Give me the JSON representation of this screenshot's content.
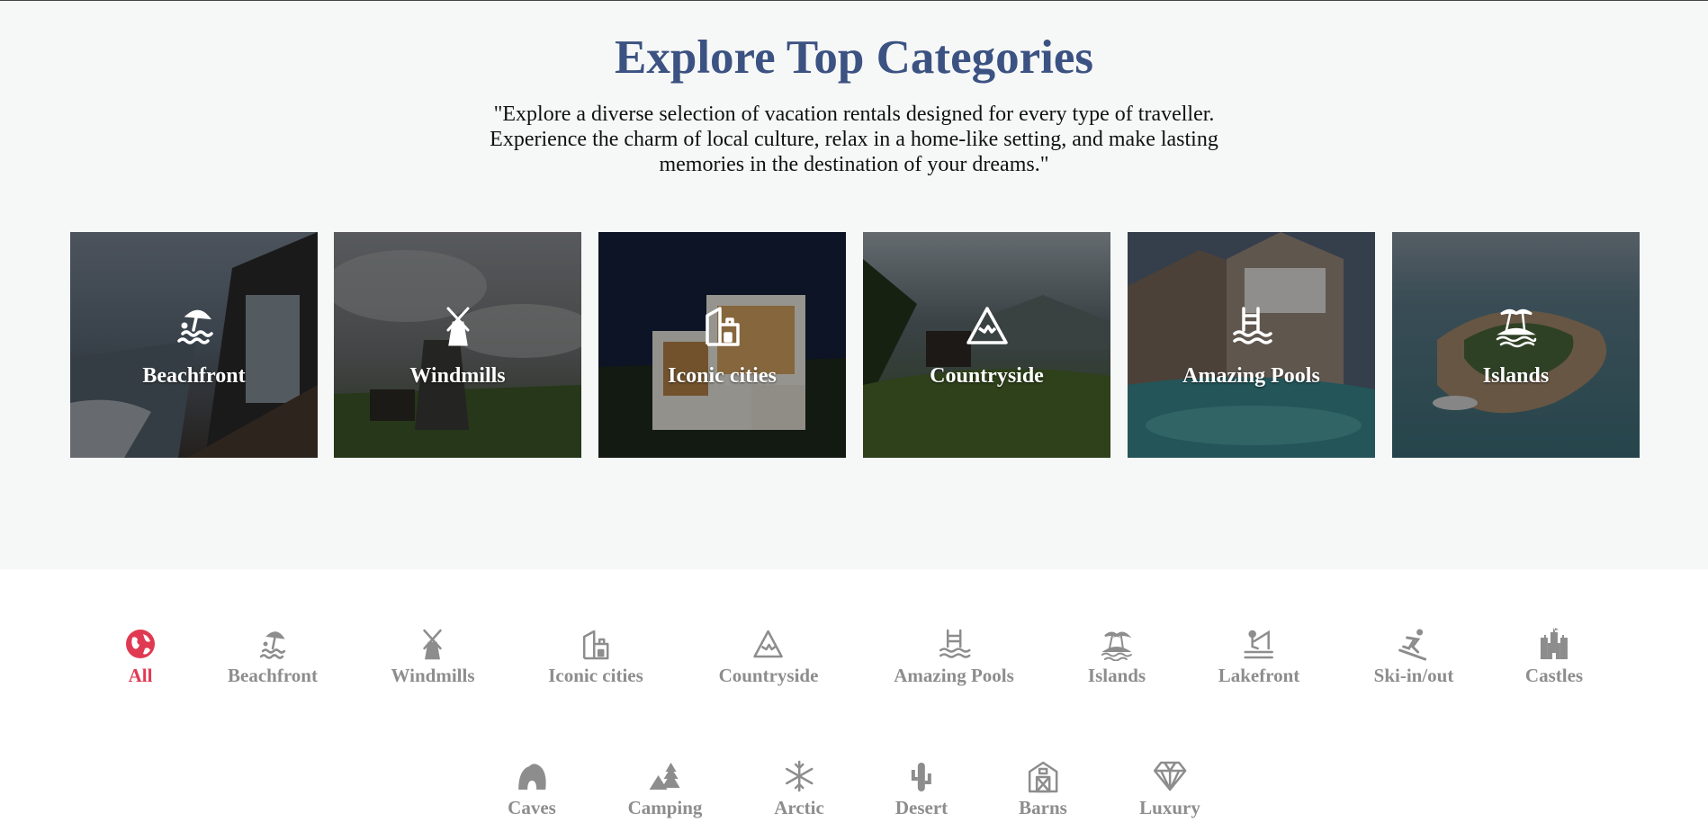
{
  "hero": {
    "title": "Explore Top Categories",
    "description": "\"Explore a diverse selection of vacation rentals designed for every type of traveller. Experience the charm of local culture, relax in a home-like setting, and make lasting memories in the destination of your dreams.\""
  },
  "cards": [
    {
      "label": "Beachfront",
      "icon": "beach-umbrella-icon"
    },
    {
      "label": "Windmills",
      "icon": "windmill-icon"
    },
    {
      "label": "Iconic cities",
      "icon": "city-building-icon"
    },
    {
      "label": "Countryside",
      "icon": "mountain-icon"
    },
    {
      "label": "Amazing Pools",
      "icon": "pool-icon"
    },
    {
      "label": "Islands",
      "icon": "island-icon"
    }
  ],
  "filters": {
    "active_color": "#e03a52",
    "inactive_color": "#8d8d8d",
    "row1": [
      {
        "label": "All",
        "icon": "globe-icon"
      },
      {
        "label": "Beachfront",
        "icon": "beach-umbrella-icon"
      },
      {
        "label": "Windmills",
        "icon": "windmill-icon"
      },
      {
        "label": "Iconic cities",
        "icon": "city-building-icon"
      },
      {
        "label": "Countryside",
        "icon": "mountain-icon"
      },
      {
        "label": "Amazing Pools",
        "icon": "pool-icon"
      },
      {
        "label": "Islands",
        "icon": "island-icon"
      },
      {
        "label": "Lakefront",
        "icon": "fishing-icon"
      },
      {
        "label": "Ski-in/out",
        "icon": "skier-icon"
      },
      {
        "label": "Castles",
        "icon": "castle-icon"
      }
    ],
    "row2": [
      {
        "label": "Caves",
        "icon": "cave-icon"
      },
      {
        "label": "Camping",
        "icon": "camping-icon"
      },
      {
        "label": "Arctic",
        "icon": "snowflake-icon"
      },
      {
        "label": "Desert",
        "icon": "cactus-icon"
      },
      {
        "label": "Barns",
        "icon": "barn-icon"
      },
      {
        "label": "Luxury",
        "icon": "diamond-icon"
      }
    ]
  }
}
